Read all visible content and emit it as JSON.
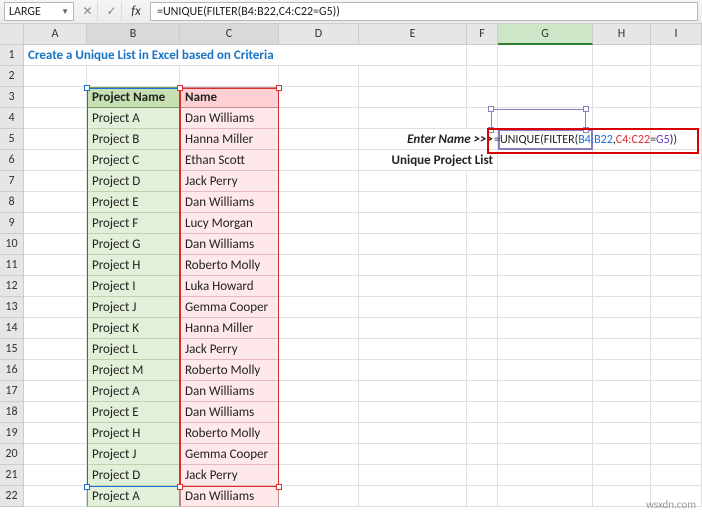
{
  "toolbar": {
    "namebox": "LARGE",
    "formula": "=UNIQUE(FILTER(B4:B22,C4:C22=G5))"
  },
  "columns": [
    "A",
    "B",
    "C",
    "D",
    "E",
    "F",
    "G",
    "H",
    "I"
  ],
  "rows": [
    "1",
    "2",
    "3",
    "4",
    "5",
    "6",
    "7",
    "8",
    "9",
    "10",
    "11",
    "12",
    "13",
    "14",
    "15",
    "16",
    "17",
    "18",
    "19",
    "20",
    "21",
    "22"
  ],
  "title": "Create a Unique List in Excel based on Criteria",
  "headers": {
    "project": "Project Name",
    "name": "Name"
  },
  "table": [
    {
      "project": "Project A",
      "name": "Dan Williams"
    },
    {
      "project": "Project B",
      "name": "Hanna Miller"
    },
    {
      "project": "Project C",
      "name": "Ethan Scott"
    },
    {
      "project": "Project D",
      "name": "Jack Perry"
    },
    {
      "project": "Project E",
      "name": "Dan Williams"
    },
    {
      "project": "Project F",
      "name": "Lucy Morgan"
    },
    {
      "project": "Project G",
      "name": "Dan Williams"
    },
    {
      "project": "Project H",
      "name": "Roberto Molly"
    },
    {
      "project": "Project I",
      "name": "Luka Howard"
    },
    {
      "project": "Project J",
      "name": "Gemma Cooper"
    },
    {
      "project": "Project K",
      "name": "Hanna Miller"
    },
    {
      "project": "Project L",
      "name": "Jack Perry"
    },
    {
      "project": "Project M",
      "name": "Roberto Molly"
    },
    {
      "project": "Project A",
      "name": "Dan Williams"
    },
    {
      "project": "Project E",
      "name": "Dan Williams"
    },
    {
      "project": "Project H",
      "name": "Roberto Molly"
    },
    {
      "project": "Project J",
      "name": "Gemma Cooper"
    },
    {
      "project": "Project D",
      "name": "Jack Perry"
    },
    {
      "project": "Project A",
      "name": "Dan Williams"
    }
  ],
  "labels": {
    "enter_name": "Enter Name >>>",
    "unique_list": "Unique Project List"
  },
  "formula_parts": {
    "p1": "=UNIQUE(FILTER(",
    "p2": "B4:B22",
    "p3": ",",
    "p4": "C4:C22",
    "p5": "=",
    "p6": "G5",
    "p7": "))"
  },
  "watermark": "wsxdn.com"
}
